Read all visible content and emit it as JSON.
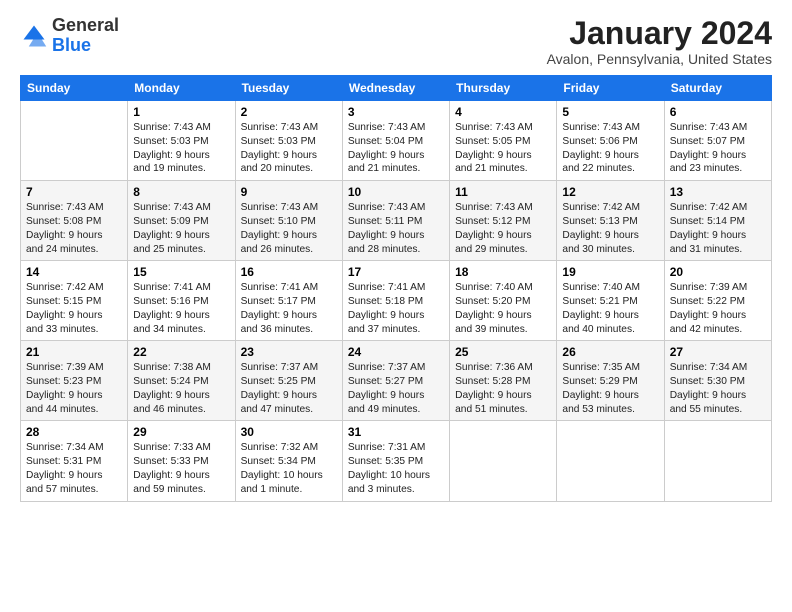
{
  "logo": {
    "line1": "General",
    "line2": "Blue"
  },
  "title": "January 2024",
  "subtitle": "Avalon, Pennsylvania, United States",
  "headers": [
    "Sunday",
    "Monday",
    "Tuesday",
    "Wednesday",
    "Thursday",
    "Friday",
    "Saturday"
  ],
  "weeks": [
    [
      {
        "day": "",
        "info": ""
      },
      {
        "day": "1",
        "info": "Sunrise: 7:43 AM\nSunset: 5:03 PM\nDaylight: 9 hours\nand 19 minutes."
      },
      {
        "day": "2",
        "info": "Sunrise: 7:43 AM\nSunset: 5:03 PM\nDaylight: 9 hours\nand 20 minutes."
      },
      {
        "day": "3",
        "info": "Sunrise: 7:43 AM\nSunset: 5:04 PM\nDaylight: 9 hours\nand 21 minutes."
      },
      {
        "day": "4",
        "info": "Sunrise: 7:43 AM\nSunset: 5:05 PM\nDaylight: 9 hours\nand 21 minutes."
      },
      {
        "day": "5",
        "info": "Sunrise: 7:43 AM\nSunset: 5:06 PM\nDaylight: 9 hours\nand 22 minutes."
      },
      {
        "day": "6",
        "info": "Sunrise: 7:43 AM\nSunset: 5:07 PM\nDaylight: 9 hours\nand 23 minutes."
      }
    ],
    [
      {
        "day": "7",
        "info": "Sunrise: 7:43 AM\nSunset: 5:08 PM\nDaylight: 9 hours\nand 24 minutes."
      },
      {
        "day": "8",
        "info": "Sunrise: 7:43 AM\nSunset: 5:09 PM\nDaylight: 9 hours\nand 25 minutes."
      },
      {
        "day": "9",
        "info": "Sunrise: 7:43 AM\nSunset: 5:10 PM\nDaylight: 9 hours\nand 26 minutes."
      },
      {
        "day": "10",
        "info": "Sunrise: 7:43 AM\nSunset: 5:11 PM\nDaylight: 9 hours\nand 28 minutes."
      },
      {
        "day": "11",
        "info": "Sunrise: 7:43 AM\nSunset: 5:12 PM\nDaylight: 9 hours\nand 29 minutes."
      },
      {
        "day": "12",
        "info": "Sunrise: 7:42 AM\nSunset: 5:13 PM\nDaylight: 9 hours\nand 30 minutes."
      },
      {
        "day": "13",
        "info": "Sunrise: 7:42 AM\nSunset: 5:14 PM\nDaylight: 9 hours\nand 31 minutes."
      }
    ],
    [
      {
        "day": "14",
        "info": "Sunrise: 7:42 AM\nSunset: 5:15 PM\nDaylight: 9 hours\nand 33 minutes."
      },
      {
        "day": "15",
        "info": "Sunrise: 7:41 AM\nSunset: 5:16 PM\nDaylight: 9 hours\nand 34 minutes."
      },
      {
        "day": "16",
        "info": "Sunrise: 7:41 AM\nSunset: 5:17 PM\nDaylight: 9 hours\nand 36 minutes."
      },
      {
        "day": "17",
        "info": "Sunrise: 7:41 AM\nSunset: 5:18 PM\nDaylight: 9 hours\nand 37 minutes."
      },
      {
        "day": "18",
        "info": "Sunrise: 7:40 AM\nSunset: 5:20 PM\nDaylight: 9 hours\nand 39 minutes."
      },
      {
        "day": "19",
        "info": "Sunrise: 7:40 AM\nSunset: 5:21 PM\nDaylight: 9 hours\nand 40 minutes."
      },
      {
        "day": "20",
        "info": "Sunrise: 7:39 AM\nSunset: 5:22 PM\nDaylight: 9 hours\nand 42 minutes."
      }
    ],
    [
      {
        "day": "21",
        "info": "Sunrise: 7:39 AM\nSunset: 5:23 PM\nDaylight: 9 hours\nand 44 minutes."
      },
      {
        "day": "22",
        "info": "Sunrise: 7:38 AM\nSunset: 5:24 PM\nDaylight: 9 hours\nand 46 minutes."
      },
      {
        "day": "23",
        "info": "Sunrise: 7:37 AM\nSunset: 5:25 PM\nDaylight: 9 hours\nand 47 minutes."
      },
      {
        "day": "24",
        "info": "Sunrise: 7:37 AM\nSunset: 5:27 PM\nDaylight: 9 hours\nand 49 minutes."
      },
      {
        "day": "25",
        "info": "Sunrise: 7:36 AM\nSunset: 5:28 PM\nDaylight: 9 hours\nand 51 minutes."
      },
      {
        "day": "26",
        "info": "Sunrise: 7:35 AM\nSunset: 5:29 PM\nDaylight: 9 hours\nand 53 minutes."
      },
      {
        "day": "27",
        "info": "Sunrise: 7:34 AM\nSunset: 5:30 PM\nDaylight: 9 hours\nand 55 minutes."
      }
    ],
    [
      {
        "day": "28",
        "info": "Sunrise: 7:34 AM\nSunset: 5:31 PM\nDaylight: 9 hours\nand 57 minutes."
      },
      {
        "day": "29",
        "info": "Sunrise: 7:33 AM\nSunset: 5:33 PM\nDaylight: 9 hours\nand 59 minutes."
      },
      {
        "day": "30",
        "info": "Sunrise: 7:32 AM\nSunset: 5:34 PM\nDaylight: 10 hours\nand 1 minute."
      },
      {
        "day": "31",
        "info": "Sunrise: 7:31 AM\nSunset: 5:35 PM\nDaylight: 10 hours\nand 3 minutes."
      },
      {
        "day": "",
        "info": ""
      },
      {
        "day": "",
        "info": ""
      },
      {
        "day": "",
        "info": ""
      }
    ]
  ]
}
